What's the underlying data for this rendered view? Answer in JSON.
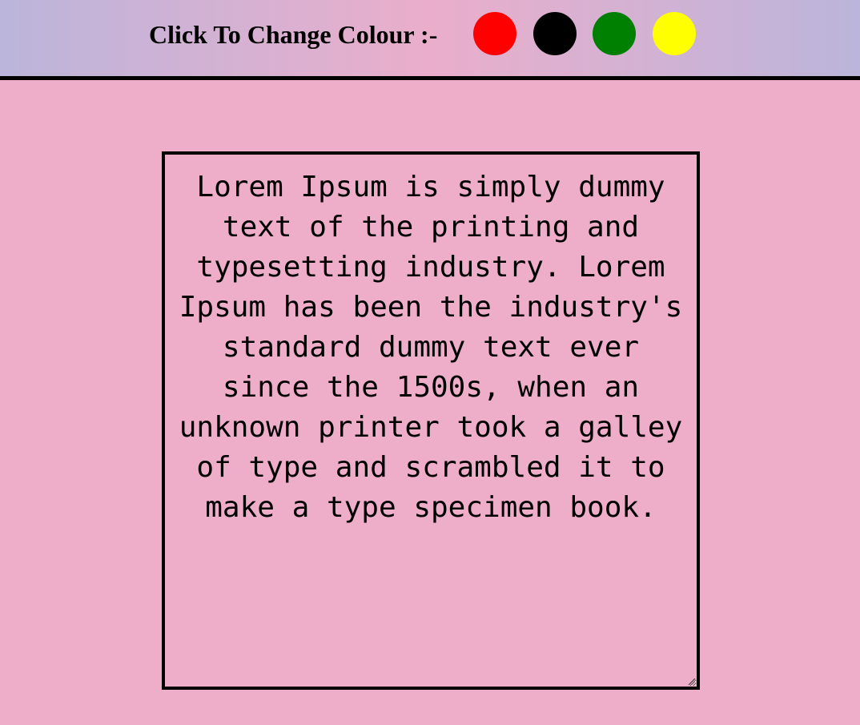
{
  "header": {
    "label": "Click To Change Colour :-",
    "swatches": [
      {
        "name": "red",
        "color": "#ff0000"
      },
      {
        "name": "black",
        "color": "#000000"
      },
      {
        "name": "green",
        "color": "#008000"
      },
      {
        "name": "yellow",
        "color": "#ffff00"
      }
    ]
  },
  "editor": {
    "text": "Lorem Ipsum is simply dummy text of the printing and typesetting industry. Lorem Ipsum has been the industry's standard dummy text ever since the 1500s, when an unknown printer took a galley of type and scrambled it to make a type specimen book."
  },
  "colors": {
    "page_background": "#eeadc9",
    "header_gradient_edge": "#bbb5db",
    "header_gradient_center": "#eaaecb",
    "border": "#000000"
  }
}
